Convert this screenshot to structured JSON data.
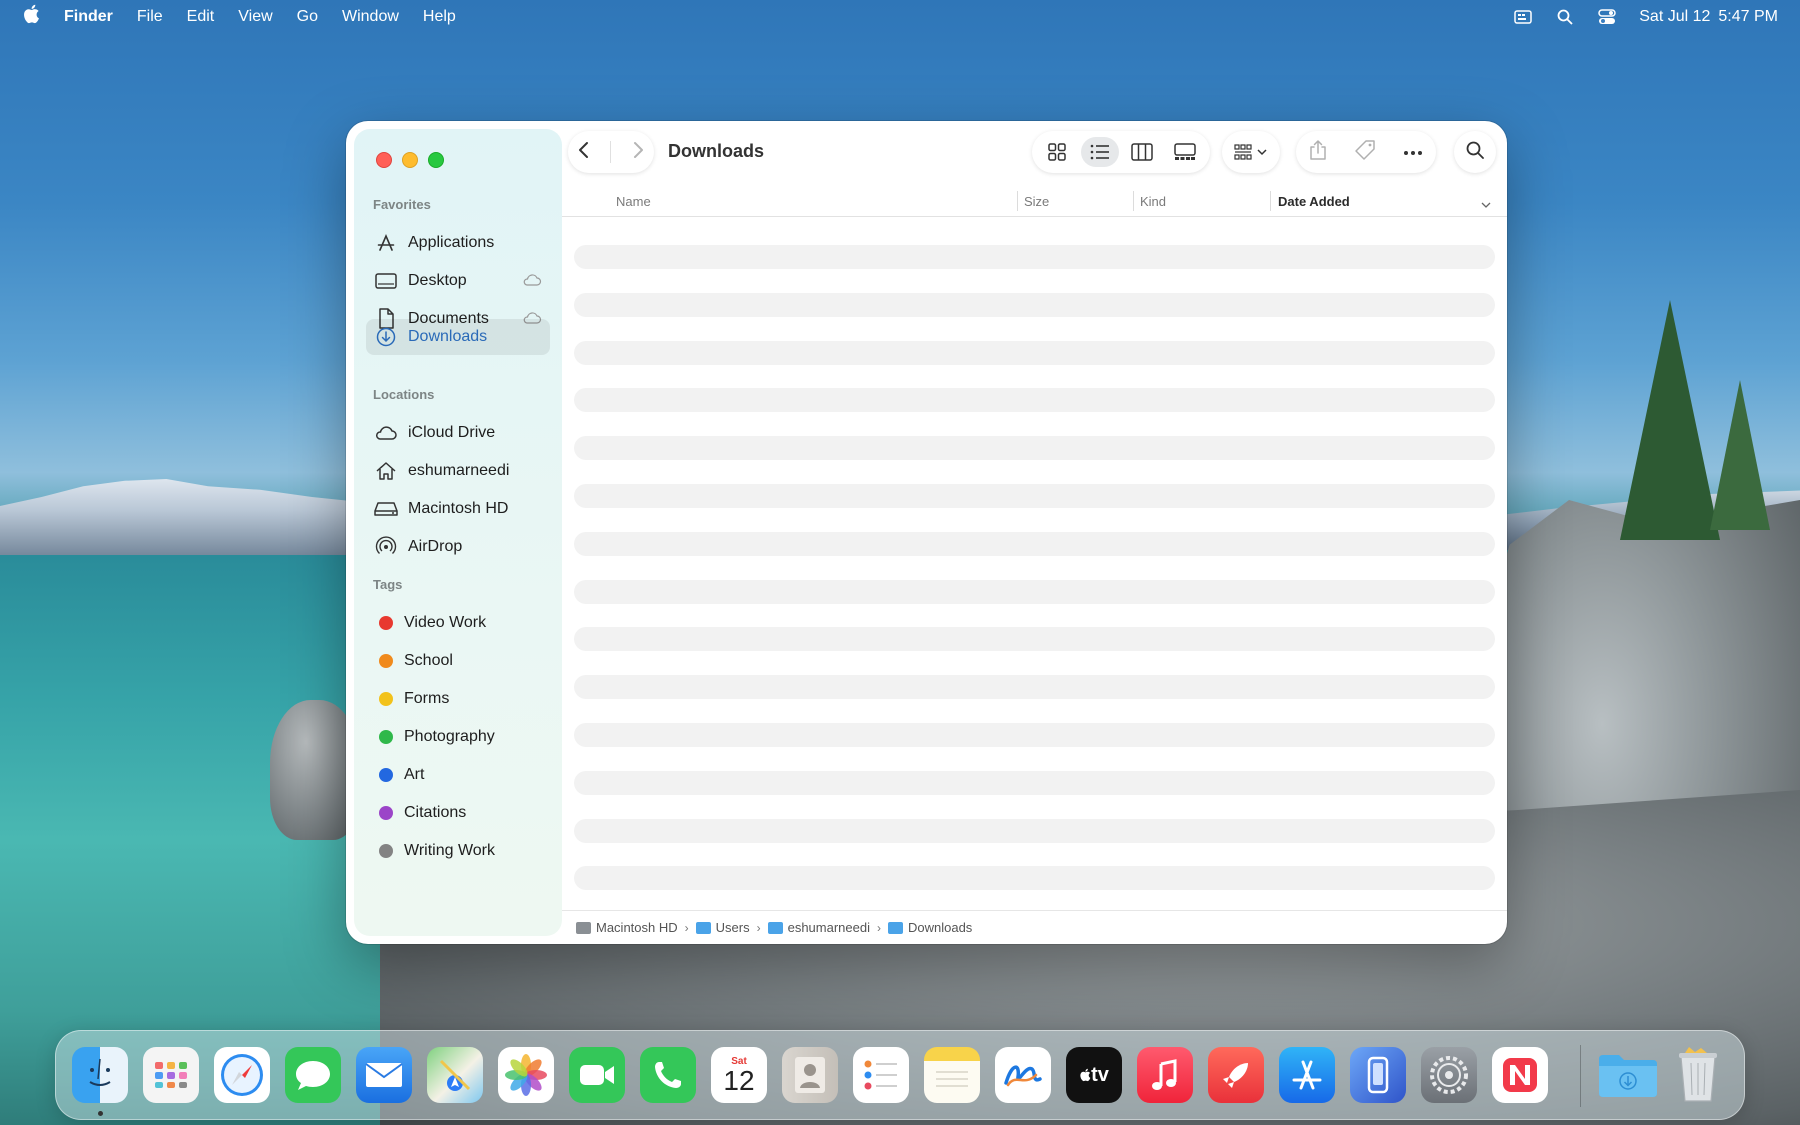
{
  "menubar": {
    "app_name": "Finder",
    "menus": [
      "File",
      "Edit",
      "View",
      "Go",
      "Window",
      "Help"
    ],
    "date": "Sat Jul 12",
    "time": "5:47 PM"
  },
  "window": {
    "title": "Downloads",
    "sidebar": {
      "favorites_header": "Favorites",
      "favorites": [
        {
          "label": "Applications",
          "icon": "applications-icon"
        },
        {
          "label": "Desktop",
          "icon": "desktop-icon"
        },
        {
          "label": "Documents",
          "icon": "document-icon"
        },
        {
          "label": "Downloads",
          "icon": "downloads-icon"
        }
      ],
      "locations_header": "Locations",
      "locations": [
        {
          "label": "iCloud Drive",
          "icon": "cloud-icon"
        },
        {
          "label": "eshumarneedi",
          "icon": "home-icon"
        },
        {
          "label": "Macintosh HD",
          "icon": "drive-icon"
        },
        {
          "label": "AirDrop",
          "icon": "airdrop-icon"
        }
      ],
      "tags_header": "Tags",
      "tags": [
        {
          "label": "Video Work",
          "color": "#e8392f"
        },
        {
          "label": "School",
          "color": "#f08a1c"
        },
        {
          "label": "Forms",
          "color": "#f2c21b"
        },
        {
          "label": "Photography",
          "color": "#2fb84a"
        },
        {
          "label": "Art",
          "color": "#2368e0"
        },
        {
          "label": "Citations",
          "color": "#9b45c8"
        },
        {
          "label": "Writing Work",
          "color": "#838383"
        }
      ]
    },
    "columns": {
      "name": "Name",
      "size": "Size",
      "kind": "Kind",
      "date_added": "Date Added"
    },
    "pathbar": [
      "Macintosh HD",
      "Users",
      "eshumarneedi",
      "Downloads"
    ]
  },
  "dock": {
    "calendar_day": "Sat",
    "calendar_date": "12",
    "tv_label": "tv",
    "apps": [
      "finder-icon",
      "launchpad-icon",
      "safari-icon",
      "messages-icon",
      "mail-icon",
      "maps-icon",
      "photos-icon",
      "facetime-icon",
      "phone-icon",
      "calendar-icon",
      "contacts-icon",
      "reminders-icon",
      "notes-icon",
      "freeform-icon",
      "tv-icon",
      "music-icon",
      "rocket-icon",
      "app-store-icon",
      "iphone-mirroring-icon",
      "system-settings-icon",
      "news-icon",
      "downloads-folder-icon",
      "trash-icon"
    ]
  }
}
